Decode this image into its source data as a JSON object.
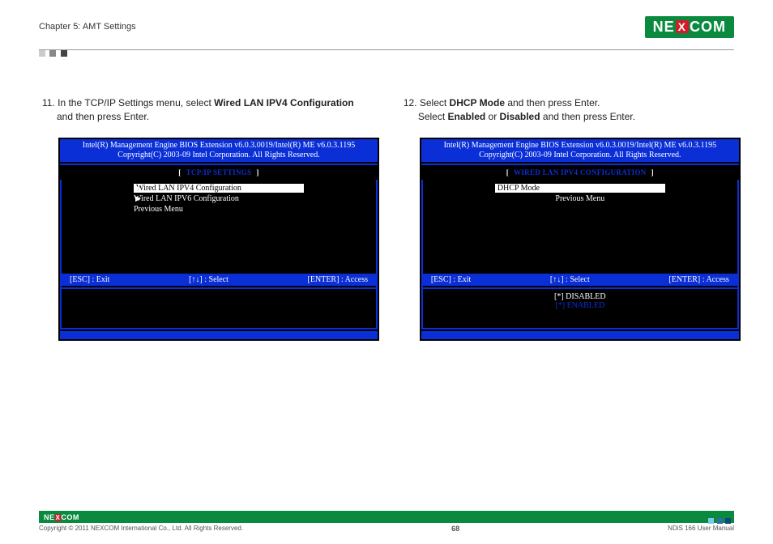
{
  "header": {
    "chapter": "Chapter 5: AMT Settings",
    "logo_left": "NE",
    "logo_x": "X",
    "logo_right": "COM"
  },
  "left": {
    "instr_num": "11.",
    "instr_pre": " In the TCP/IP Settings menu, select ",
    "instr_bold": "Wired LAN IPV4 Configuration",
    "instr_post": " and then press Enter.",
    "bios_title1": "Intel(R) Management Engine BIOS Extension v6.0.3.0019/Intel(R) ME v6.0.3.1195",
    "bios_title2": "Copyright(C) 2003-09 Intel Corporation. All Rights Reserved.",
    "section": "TCP/IP SETTINGS",
    "menu1": "Wired LAN IPV4 Configuration",
    "menu2": "Wired LAN IPV6 Configuration",
    "menu3": "Previous Menu",
    "help_esc": "[ESC] : Exit",
    "help_arrows": "[↑↓] : Select",
    "help_enter": "[ENTER] : Access"
  },
  "right": {
    "instr_num": "12.",
    "instr_pre": " Select ",
    "instr_bold1": "DHCP Mode",
    "instr_mid1": " and then press Enter.",
    "instr_line2_pre": "Select ",
    "instr_bold2": "Enabled",
    "instr_or": " or ",
    "instr_bold3": "Disabled",
    "instr_post": " and then press Enter.",
    "bios_title1": "Intel(R) Management Engine BIOS Extension v6.0.3.0019/Intel(R) ME v6.0.3.1195",
    "bios_title2": "Copyright(C) 2003-09 Intel Corporation. All Rights Reserved.",
    "section": "WIRED LAN IPV4 CONFIGURATION",
    "menu1": "DHCP Mode",
    "menu2": "Previous Menu",
    "help_esc": "[ESC] : Exit",
    "help_arrows": "[↑↓] : Select",
    "help_enter": "[ENTER] : Access",
    "opt1": "[*] DISABLED",
    "opt2": "[*] ENABLED"
  },
  "footer": {
    "copyright": "Copyright © 2011 NEXCOM International Co., Ltd. All Rights Reserved.",
    "page": "68",
    "manual": "NDiS 166 User Manual",
    "logo_left": "NE",
    "logo_x": "X",
    "logo_right": "COM"
  }
}
